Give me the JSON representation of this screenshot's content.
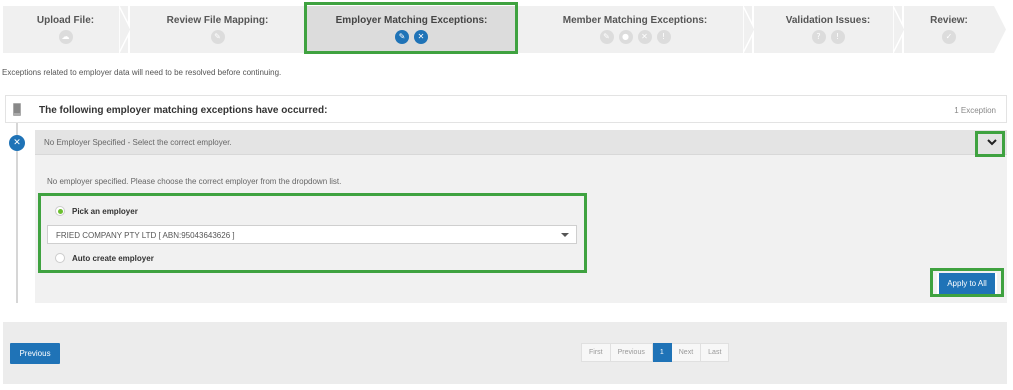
{
  "wizard": {
    "steps": [
      {
        "label": "Upload File:",
        "icons": [
          "cloud-upload-icon"
        ]
      },
      {
        "label": "Review File Mapping:",
        "icons": [
          "edit-icon"
        ]
      },
      {
        "label": "Employer Matching Exceptions:",
        "icons": [
          "pencil-icon",
          "x-icon"
        ],
        "current": true
      },
      {
        "label": "Member Matching Exceptions:",
        "icons": [
          "pencil-icon",
          "user-icon",
          "x-icon",
          "exclamation-icon"
        ]
      },
      {
        "label": "Validation Issues:",
        "icons": [
          "question-icon",
          "exclamation-icon"
        ]
      },
      {
        "label": "Review:",
        "icons": [
          "check-icon"
        ]
      }
    ]
  },
  "intro_text": "Exceptions related to employer data will need to be resolved before continuing.",
  "panel": {
    "title": "The following employer matching exceptions have occurred:",
    "count": "1 Exception"
  },
  "exception": {
    "title": "No Employer Specified - Select the correct employer.",
    "description": "No employer specified. Please choose the correct employer from the dropdown list.",
    "option_pick": "Pick an employer",
    "selected_employer": "FRIED COMPANY PTY LTD [ ABN:95043643626 ]",
    "option_auto": "Auto create employer",
    "apply_label": "Apply to All"
  },
  "footer": {
    "previous_label": "Previous",
    "pager": {
      "first": "First",
      "previous": "Previous",
      "current": "1",
      "next": "Next",
      "last": "Last"
    }
  },
  "colors": {
    "accent": "#1f73b7",
    "highlight": "#3fa240",
    "radio_on": "#6bbf2f"
  }
}
